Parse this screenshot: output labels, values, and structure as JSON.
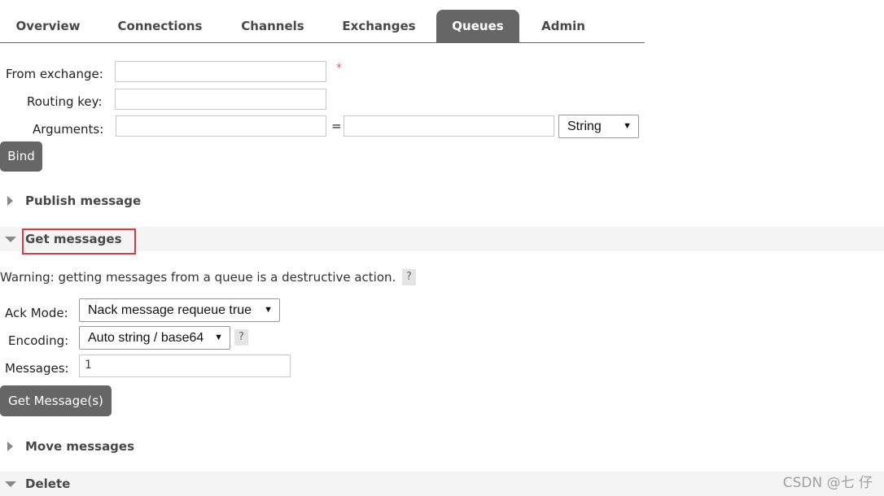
{
  "nav": {
    "tabs": [
      {
        "label": "Overview",
        "active": false
      },
      {
        "label": "Connections",
        "active": false
      },
      {
        "label": "Channels",
        "active": false
      },
      {
        "label": "Exchanges",
        "active": false
      },
      {
        "label": "Queues",
        "active": true
      },
      {
        "label": "Admin",
        "active": false
      }
    ]
  },
  "bind_form": {
    "from_exchange_label": "From exchange:",
    "required_mark": "*",
    "routing_key_label": "Routing key:",
    "arguments_label": "Arguments:",
    "arguments_equals": "=",
    "arguments_type": "String",
    "bind_button": "Bind"
  },
  "sections": {
    "publish": "Publish message",
    "get": "Get messages",
    "move": "Move messages",
    "delete": "Delete"
  },
  "get_messages": {
    "warning": "Warning: getting messages from a queue is a destructive action.",
    "help": "?",
    "ack_mode_label": "Ack Mode:",
    "ack_mode_value": "Nack message requeue true",
    "encoding_label": "Encoding:",
    "encoding_value": "Auto string / base64",
    "messages_label": "Messages:",
    "messages_value": "1",
    "get_button": "Get Message(s)"
  },
  "dropdown_arrow": "▼",
  "watermark": "CSDN @七 仔",
  "colors": {
    "tab_active_bg": "#666666",
    "button_bg": "#666666",
    "highlight_border": "#e0383e",
    "required": "#e36060"
  }
}
